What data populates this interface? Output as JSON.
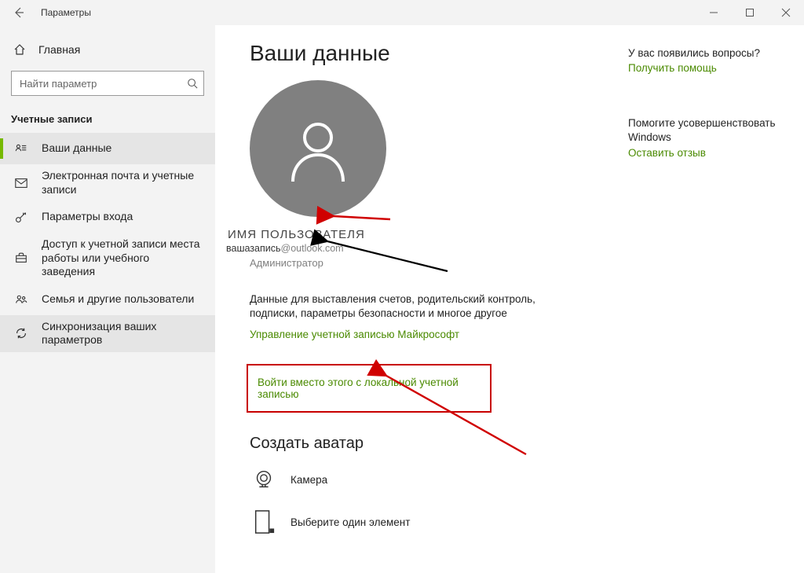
{
  "titlebar": {
    "title": "Параметры"
  },
  "sidebar": {
    "home": "Главная",
    "search_placeholder": "Найти параметр",
    "section": "Учетные записи",
    "items": [
      {
        "id": "your-info",
        "label": "Ваши данные",
        "icon": "user-card"
      },
      {
        "id": "email",
        "label": "Электронная почта и учетные записи",
        "icon": "mail"
      },
      {
        "id": "signin",
        "label": "Параметры входа",
        "icon": "key"
      },
      {
        "id": "work-school",
        "label": "Доступ к учетной записи места работы или учебного заведения",
        "icon": "briefcase"
      },
      {
        "id": "family",
        "label": "Семья и другие пользователи",
        "icon": "people"
      },
      {
        "id": "sync",
        "label": "Синхронизация ваших параметров",
        "icon": "sync"
      }
    ]
  },
  "main": {
    "page_title": "Ваши данные",
    "user_name": "ИМЯ ПОЛЬЗОВАТЕЛЯ",
    "account_local": "вашазапись",
    "account_domain": "@outlook.com",
    "role": "Администратор",
    "billing_desc": "Данные для выставления счетов, родительский контроль, подписки, параметры безопасности и многое другое",
    "manage_link": "Управление учетной записью Майкрософт",
    "local_signin_link": "Войти вместо этого с локальной учетной записью",
    "create_avatar_heading": "Создать аватар",
    "camera_label": "Камера",
    "browse_label": "Выберите один элемент"
  },
  "help": {
    "q1": "У вас появились вопросы?",
    "link1": "Получить помощь",
    "improve": "Помогите усовершенствовать Windows",
    "feedback": "Оставить отзыв"
  }
}
